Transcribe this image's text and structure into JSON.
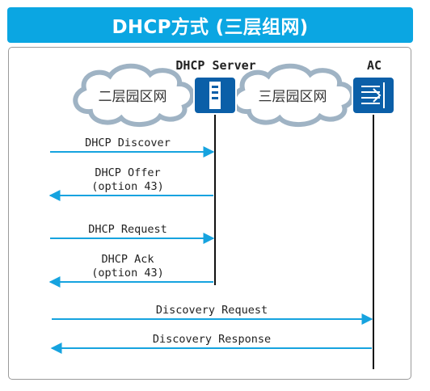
{
  "title": "DHCP方式 (三层组网)",
  "nodes": {
    "dhcp_server": {
      "label": "DHCP Server",
      "icon": "server-icon"
    },
    "ac": {
      "label": "AC",
      "icon": "access-controller-icon"
    }
  },
  "clouds": {
    "left": {
      "label": "二层园区网"
    },
    "right": {
      "label": "三层园区网"
    }
  },
  "messages": [
    {
      "line1": "DHCP Discover",
      "line2": "",
      "direction": "to-server"
    },
    {
      "line1": "DHCP Offer",
      "line2": "(option 43)",
      "direction": "from-server"
    },
    {
      "line1": "DHCP Request",
      "line2": "",
      "direction": "to-server"
    },
    {
      "line1": "DHCP Ack",
      "line2": "(option 43)",
      "direction": "from-server"
    },
    {
      "line1": "Discovery Request",
      "line2": "",
      "direction": "to-ac"
    },
    {
      "line1": "Discovery Response",
      "line2": "",
      "direction": "from-ac"
    }
  ],
  "colors": {
    "title_bg": "#0ba6e2",
    "arrow": "#16a3df",
    "node_fill": "#0b5fa8",
    "cloud_stroke": "#9fb3c4"
  }
}
